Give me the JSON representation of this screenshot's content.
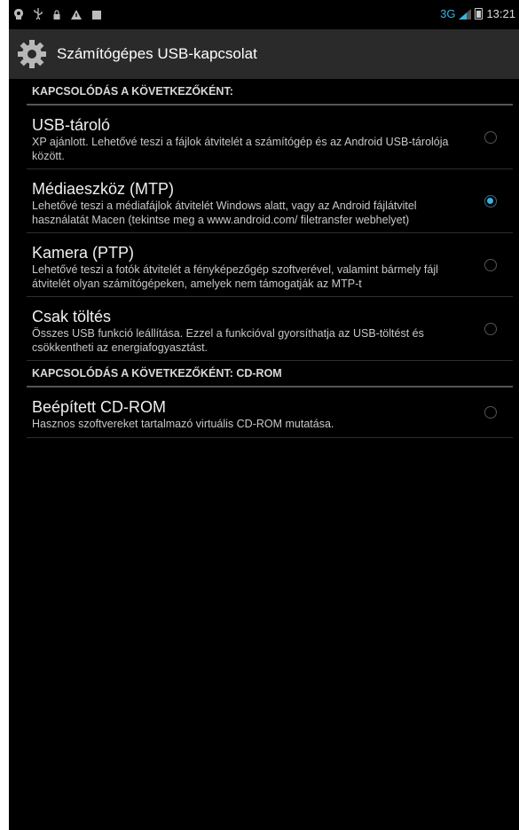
{
  "status_bar": {
    "network": "3G",
    "time": "13:21",
    "icons": [
      "notification-icon",
      "usb-icon",
      "lock-icon",
      "warning-icon",
      "square-icon"
    ]
  },
  "action_bar": {
    "title": "Számítógépes USB-kapcsolat"
  },
  "sections": [
    {
      "header": "KAPCSOLÓDÁS A KÖVETKEZŐKÉNT:",
      "items": [
        {
          "title": "USB-tároló",
          "summary": "XP ajánlott. Lehetővé teszi a fájlok átvitelét a számítógép és az Android USB-tárolója között.",
          "checked": false
        },
        {
          "title": "Médiaeszköz (MTP)",
          "summary": "Lehetővé teszi a médiafájlok átvitelét Windows alatt, vagy az Android fájlátvitel használatát Macen (tekintse meg a www.android.com/ filetransfer webhelyet)",
          "checked": true
        },
        {
          "title": "Kamera (PTP)",
          "summary": "Lehetővé teszi a fotók átvitelét a fényképezőgép szoftverével, valamint bármely fájl átvitelét olyan számítógépeken, amelyek nem támogatják az MTP-t",
          "checked": false
        },
        {
          "title": "Csak töltés",
          "summary": "Összes USB funkció leállítása. Ezzel a funkcióval gyorsíthatja az USB-töltést és csökkentheti az energiafogyasztást.",
          "checked": false
        }
      ]
    },
    {
      "header": "KAPCSOLÓDÁS A KÖVETKEZŐKÉNT: CD-ROM",
      "items": [
        {
          "title": "Beépített CD-ROM",
          "summary": "Hasznos szoftvereket tartalmazó virtuális CD-ROM mutatása.",
          "checked": false
        }
      ]
    }
  ],
  "colors": {
    "accent": "#33b5e5",
    "background": "#000000",
    "action_bar": "#2a2a2a"
  }
}
